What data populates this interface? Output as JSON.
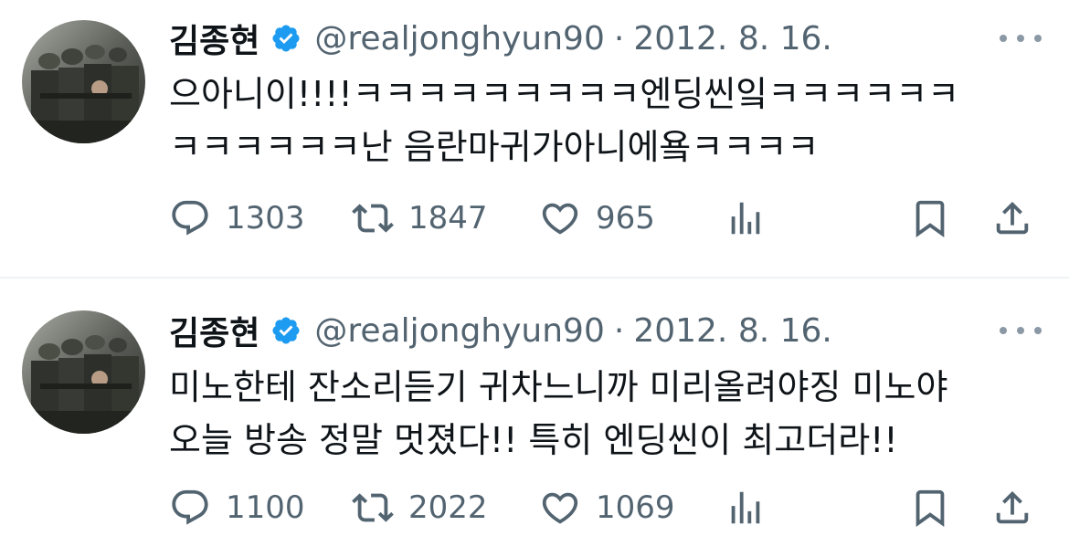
{
  "tweets": [
    {
      "display_name": "김종현",
      "handle": "@realjonghyun90",
      "separator": "·",
      "date": "2012. 8. 16.",
      "text_lines": [
        "으아니이!!!!ㅋㅋㅋㅋㅋㅋㅋㅋㅋ엔딩씬잌ㅋㅋㅋㅋㅋㅋ",
        "ㅋㅋㅋㅋㅋㅋ난 음란마귀가아니에욬ㅋㅋㅋㅋ"
      ],
      "replies": "1303",
      "retweets": "1847",
      "likes": "965"
    },
    {
      "display_name": "김종현",
      "handle": "@realjonghyun90",
      "separator": "·",
      "date": "2012. 8. 16.",
      "text_lines": [
        "미노한테 잔소리듣기 귀차느니까 미리올려야징 미노야",
        "오늘 방송 정말 멋졌다!! 특히 엔딩씬이 최고더라!!"
      ],
      "replies": "1100",
      "retweets": "2022",
      "likes": "1069"
    }
  ],
  "icons": {
    "verified": "verified-badge-icon",
    "reply": "reply-icon",
    "retweet": "retweet-icon",
    "like": "heart-icon",
    "views": "views-chart-icon",
    "bookmark": "bookmark-icon",
    "share": "share-icon",
    "more": "more-icon"
  },
  "colors": {
    "verified": "#1d9bf0",
    "text": "#0f1419",
    "secondary": "#536471",
    "divider": "#eff3f4"
  }
}
